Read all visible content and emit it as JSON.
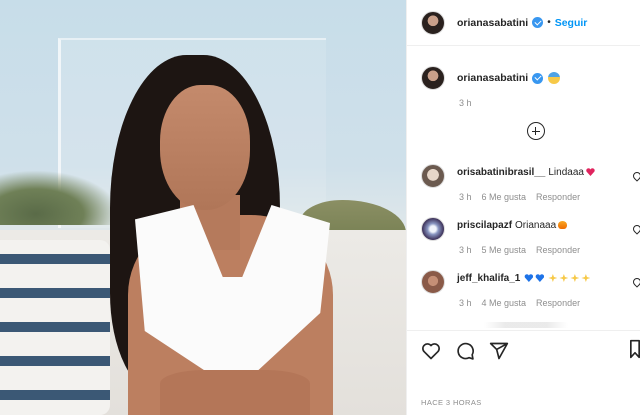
{
  "post": {
    "author": "orianasabatini",
    "follow_label": "Seguir",
    "separator": "•",
    "caption_time": "3 h",
    "posted_ago": "HACE 3 HORAS"
  },
  "comments": [
    {
      "user": "orisabatinibrasil__",
      "text": "Lindaaa",
      "emoji": "red-heart",
      "time": "3 h",
      "likes": "6 Me gusta",
      "reply": "Responder"
    },
    {
      "user": "priscilapazf",
      "text": "Orianaaa",
      "emoji": "fire",
      "time": "3 h",
      "likes": "5 Me gusta",
      "reply": "Responder"
    },
    {
      "user": "jeff_khalifa_1",
      "text": "",
      "emoji": "blue-hearts-sparkles",
      "time": "3 h",
      "likes": "4 Me gusta",
      "reply": "Responder"
    }
  ],
  "colors": {
    "accent": "#0095f6",
    "verified": "#3897f0",
    "muted": "#8e8e8e"
  },
  "icons": [
    "heart-icon",
    "comment-icon",
    "share-icon",
    "bookmark-icon",
    "add-comment-icon",
    "verified-icon"
  ]
}
